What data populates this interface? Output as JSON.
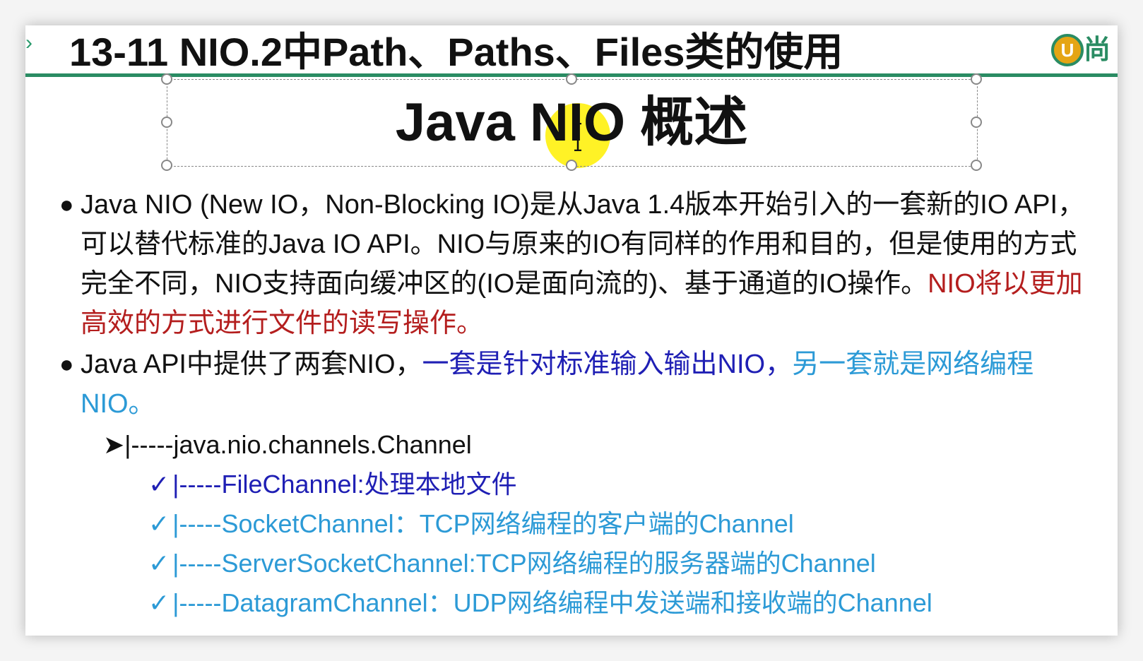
{
  "slide": {
    "title": "13-11 NIO.2中Path、Paths、Files类的使用",
    "logo_letter": "U",
    "logo_text": "尚",
    "subtitle": "Java NIO 概述"
  },
  "bullets": [
    {
      "text_plain": "Java NIO (New IO，Non-Blocking IO)是从Java 1.4版本开始引入的一套新的IO API，可以替代标准的Java IO API。NIO与原来的IO有同样的作用和目的，但是使用的方式完全不同，NIO支持面向缓冲区的(IO是面向流的)、基于通道的IO操作。",
      "text_red": "NIO将以更加高效的方式进行文件的读写操作。"
    },
    {
      "text_plain": "Java API中提供了两套NIO，",
      "text_blue": "一套是针对标准输入输出NIO，",
      "text_lightblue": "另一套就是网络编程NIO。"
    }
  ],
  "channels": {
    "root_arrow": "➤",
    "root": "|-----java.nio.channels.Channel",
    "check": "✓",
    "items": [
      "|-----FileChannel:处理本地文件",
      "|-----SocketChannel：TCP网络编程的客户端的Channel",
      "|-----ServerSocketChannel:TCP网络编程的服务器端的Channel",
      "|-----DatagramChannel：UDP网络编程中发送端和接收端的Channel"
    ]
  },
  "colors": {
    "accent_green": "#2a8c63",
    "red_text": "#b41e1e",
    "blue_text": "#1f1fb4",
    "lightblue_text": "#2c9ad6"
  }
}
